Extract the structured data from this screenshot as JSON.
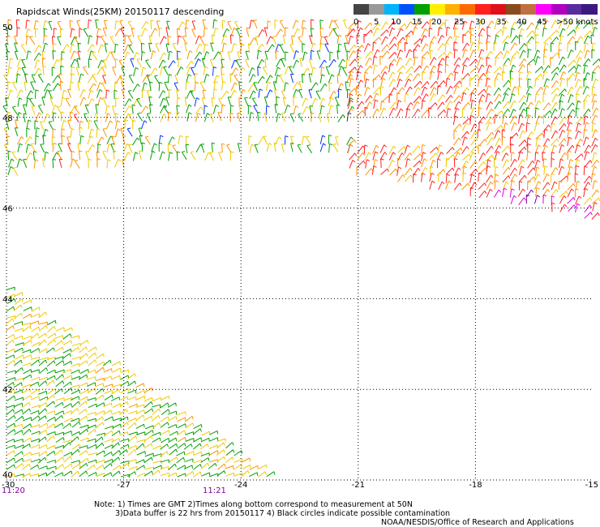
{
  "title": "Rapidscat Winds(25KM) 20150117 descending",
  "legend": {
    "colors": [
      "#444444",
      "#999999",
      "#00b4ff",
      "#0050ff",
      "#00a000",
      "#fff000",
      "#ffb000",
      "#ff6a00",
      "#ff2020",
      "#e0101a",
      "#8a4a20",
      "#c07040",
      "#ff00ff",
      "#b000c0",
      "#5a2aa0",
      "#3a1a80"
    ],
    "labels": [
      "0",
      "5",
      "10",
      "15",
      "20",
      "25",
      "30",
      "35",
      "40",
      "45",
      ">50 knots"
    ]
  },
  "map": {
    "lon_min": -30,
    "lon_max": -15,
    "lat_min": 40,
    "lat_max": 50,
    "lon_ticks": [
      "-30",
      "-27",
      "-24",
      "-21",
      "-18",
      "-15"
    ],
    "lat_labels": [
      "50",
      "48",
      "46",
      "44",
      "42",
      "40"
    ],
    "time_labels": [
      "11:20",
      "11:21"
    ],
    "colors": {
      "green": "#00a000",
      "yellow": "#f0c800",
      "orange": "#ff9000",
      "red": "#ff2020",
      "blue": "#0030ff",
      "magenta": "#e000e0",
      "purple": "#8000a0"
    }
  },
  "notes": {
    "line1": "Note: 1) Times are GMT 2)Times along bottom correspond to measurement at 50N",
    "line2": "3)Data buffer is 22 hrs from 20150117 4) Black circles indicate possible contamination",
    "credit": "NOAA/NESDIS/Office of Research and Applications"
  }
}
